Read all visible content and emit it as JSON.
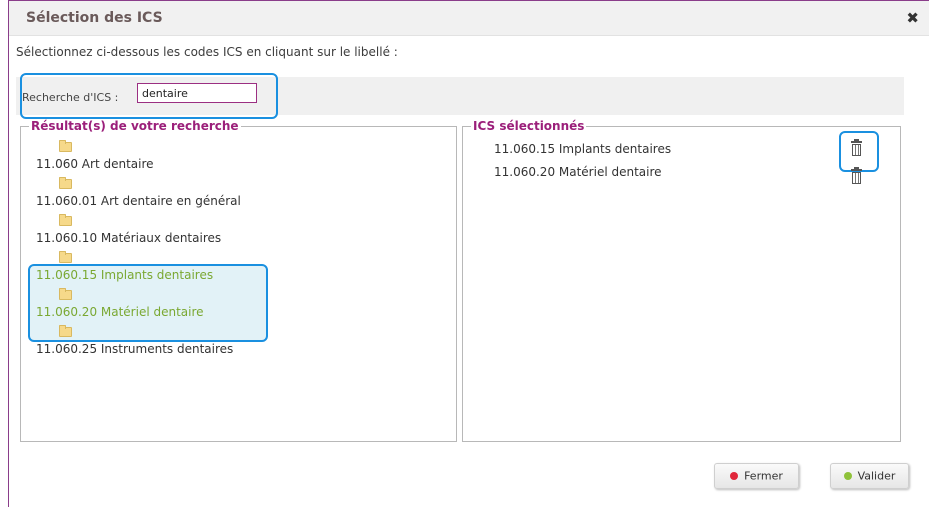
{
  "dialog": {
    "title": "Sélection des ICS",
    "close_label": "✖",
    "instructions": "Sélectionnez ci-dessous les codes ICS en cliquant sur le libellé :"
  },
  "search": {
    "label": "Recherche d'ICS :",
    "value": "dentaire"
  },
  "results": {
    "legend": "Résultat(s) de votre recherche",
    "items": [
      {
        "label": "11.060 Art dentaire",
        "selected": false
      },
      {
        "label": "11.060.01 Art dentaire en général",
        "selected": false
      },
      {
        "label": "11.060.10 Matériaux dentaires",
        "selected": false
      },
      {
        "label": "11.060.15 Implants dentaires",
        "selected": true
      },
      {
        "label": "11.060.20 Matériel dentaire",
        "selected": true
      },
      {
        "label": "11.060.25 Instruments dentaires",
        "selected": false
      }
    ]
  },
  "selected_panel": {
    "legend": "ICS sélectionnés",
    "items": [
      {
        "label": "11.060.15 Implants dentaires"
      },
      {
        "label": "11.060.20 Matériel dentaire"
      }
    ]
  },
  "buttons": {
    "close_label": "Fermer",
    "validate_label": "Valider"
  },
  "colors": {
    "accent": "#9b1f7a",
    "selected_text": "#7aa832",
    "highlight": "#1a90e0",
    "close_dot": "#e0263a",
    "validate_dot": "#8fc23a"
  },
  "icons": [
    "close-icon",
    "folder-icon",
    "trash-icon",
    "red-dot-icon",
    "green-dot-icon"
  ]
}
